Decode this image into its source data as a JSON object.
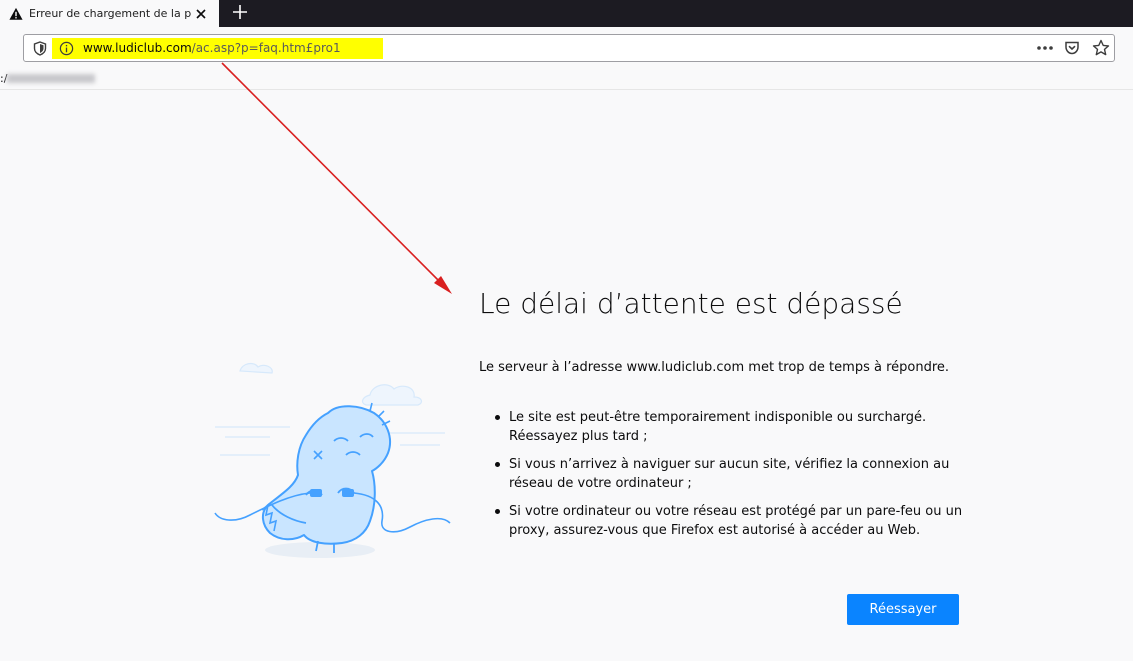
{
  "tab": {
    "title": "Erreur de chargement de la page",
    "icon": "warning-icon",
    "close_icon": "close-icon"
  },
  "toolbar": {
    "new_tab_icon": "plus-icon",
    "url_host": "www.ludiclub.com",
    "url_path": "/ac.asp?p=faq.htm£pro1",
    "highlight_color": "#ffff00",
    "icons": [
      "shield-icon",
      "info-icon",
      "more-dots-icon",
      "pocket-icon",
      "star-icon"
    ]
  },
  "status": {
    "text": ":/"
  },
  "error": {
    "title": "Le délai d’attente est dépassé",
    "description": "Le serveur à l’adresse www.ludiclub.com met trop de temps à répondre.",
    "items": [
      "Le site est peut-être temporairement indisponible ou surchargé. Réessayez plus tard ;",
      "Si vous n’arrivez à naviguer sur aucun site, vérifiez la connexion au réseau de votre ordinateur ;",
      "Si votre ordinateur ou votre réseau est protégé par un pare-feu ou un proxy, assurez-vous que Firefox est autorisé à accéder au Web."
    ],
    "retry_label": "Réessayer"
  },
  "colors": {
    "accent": "#0a84ff",
    "annotation_arrow": "#d92020",
    "illustration": "#45a1ff"
  }
}
